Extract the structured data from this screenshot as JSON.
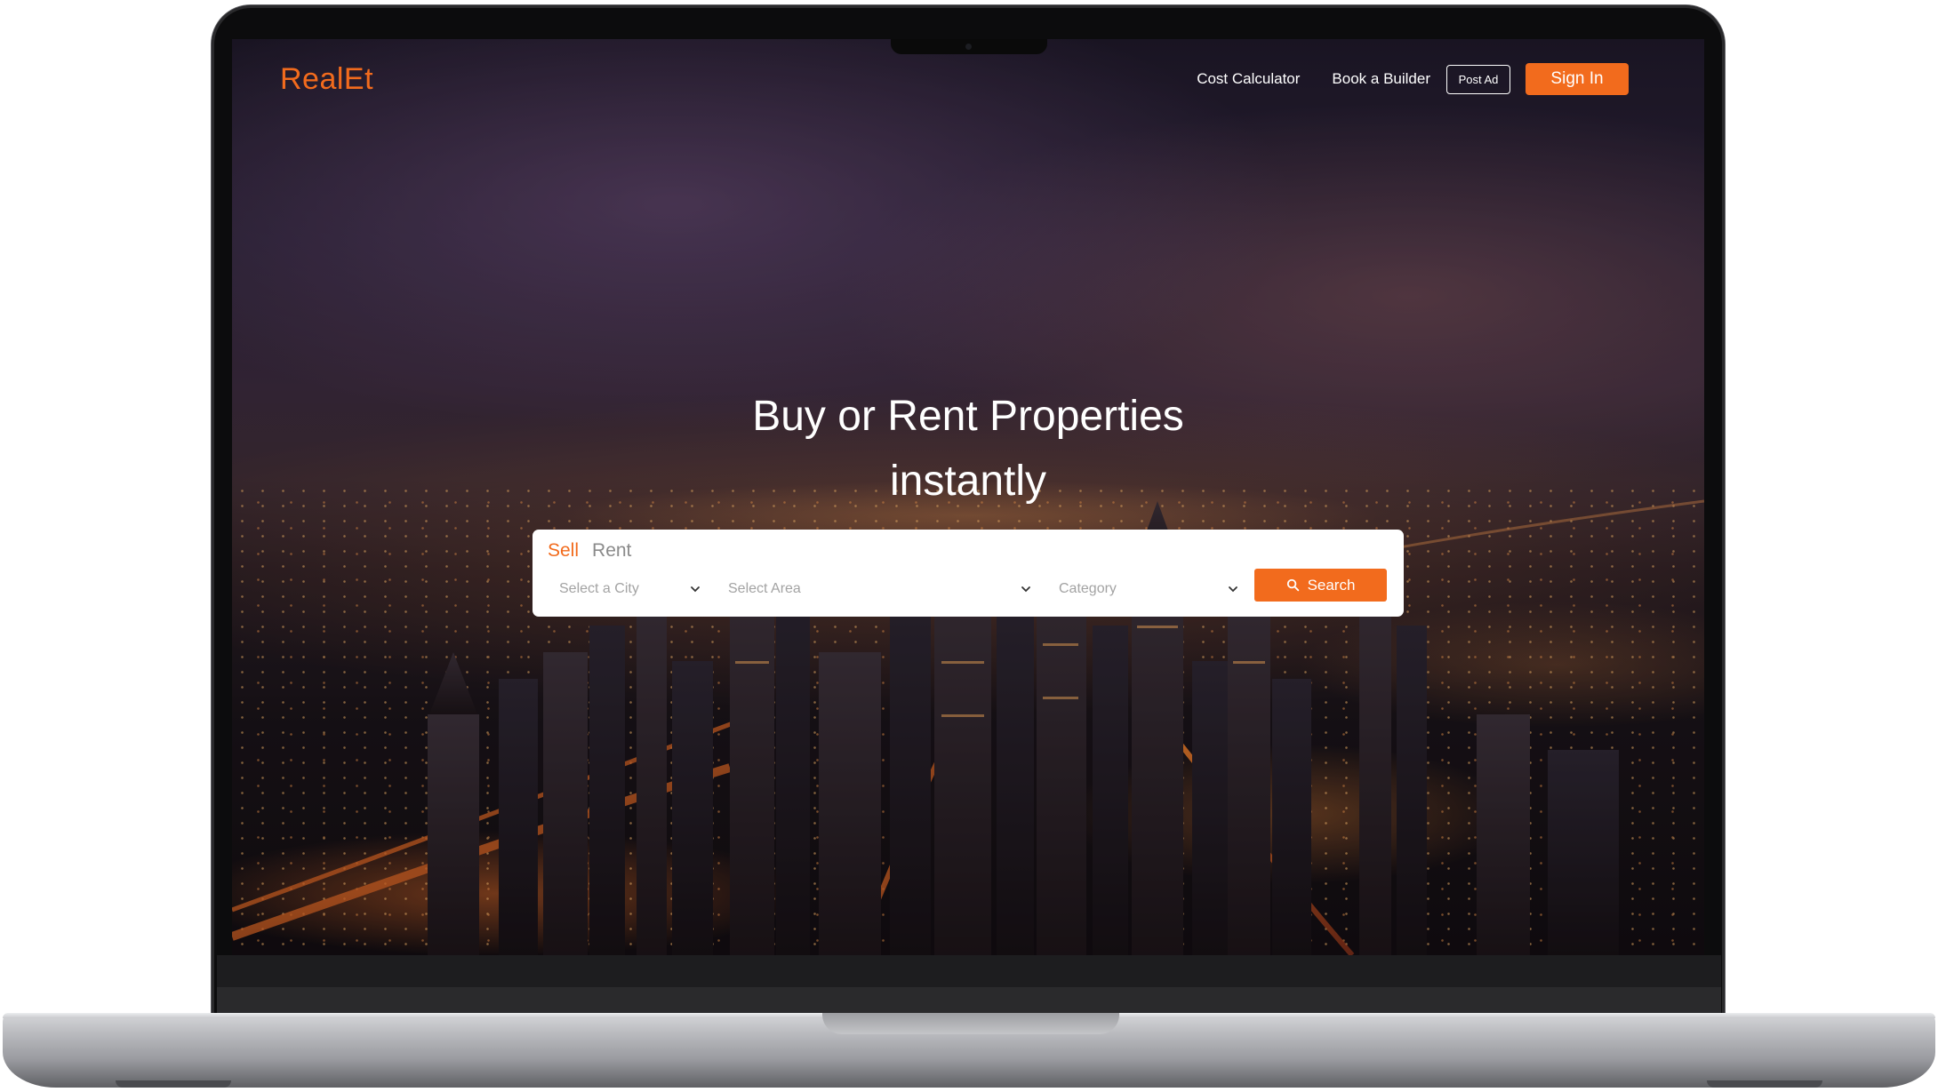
{
  "brand": {
    "logo_text": "RealEt",
    "accent_color": "#f26b1d"
  },
  "nav": {
    "links": [
      {
        "label": "Cost Calculator"
      },
      {
        "label": "Book a Builder"
      }
    ],
    "post_ad_label": "Post Ad",
    "sign_in_label": "Sign In"
  },
  "hero": {
    "title_line1": "Buy or Rent Properties",
    "title_line2": "instantly"
  },
  "search": {
    "tabs": [
      {
        "label": "Sell",
        "active": true
      },
      {
        "label": "Rent",
        "active": false
      }
    ],
    "city_placeholder": "Select a City",
    "area_placeholder": "Select Area",
    "category_placeholder": "Category",
    "button_label": "Search",
    "button_icon": "search-icon",
    "dropdown_icon": "chevron-down-icon"
  }
}
